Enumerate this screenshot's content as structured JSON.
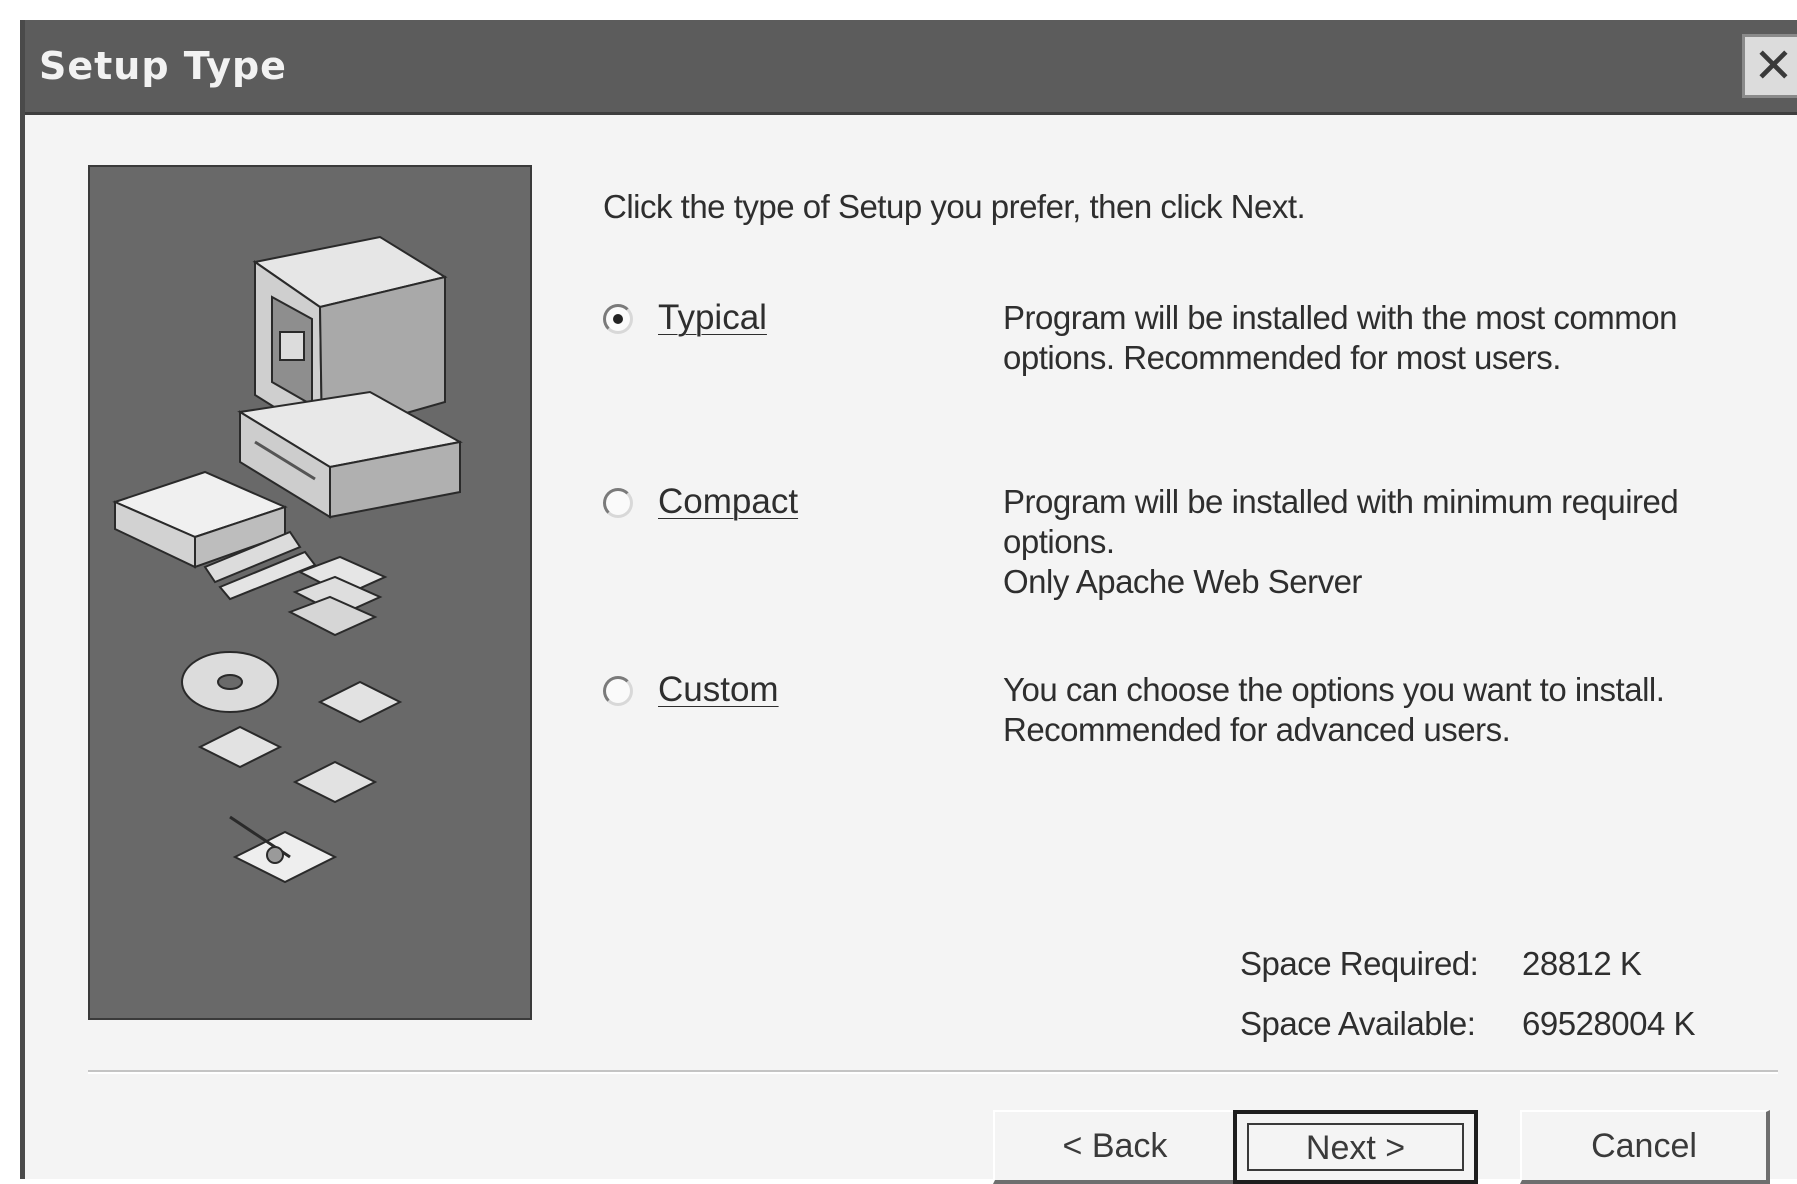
{
  "window": {
    "title": "Setup Type",
    "close_label": "✕"
  },
  "instruction": "Click the type of Setup you prefer, then click Next.",
  "options": [
    {
      "label": "Typical",
      "selected": true,
      "description": [
        "Program will be installed with the most common",
        "options. Recommended for most users."
      ]
    },
    {
      "label": "Compact",
      "selected": false,
      "description": [
        "Program will be installed with minimum required",
        "options.",
        "Only Apache Web Server"
      ]
    },
    {
      "label": "Custom",
      "selected": false,
      "description": [
        "You can choose the options you want to install.",
        "Recommended for advanced users."
      ]
    }
  ],
  "space": {
    "required_label": "Space Required:",
    "required_value": "28812 K",
    "available_label": "Space Available:",
    "available_value": "69528004 K"
  },
  "buttons": {
    "back": "< Back",
    "next": "Next >",
    "cancel": "Cancel"
  },
  "icons": {
    "illustration": "setup-computer-illustration",
    "close": "close-icon"
  },
  "colors": {
    "titlebar": "#5c5c5c",
    "panel": "#696969",
    "dialog_bg": "#f4f4f4"
  }
}
